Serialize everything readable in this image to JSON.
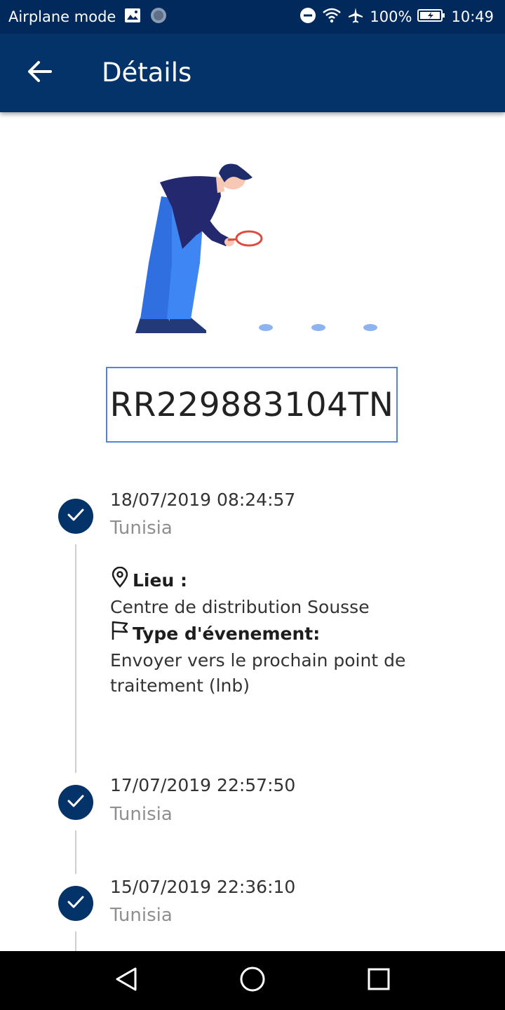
{
  "status_bar": {
    "mode_label": "Airplane mode",
    "battery": "100%",
    "time": "10:49"
  },
  "app_bar": {
    "title": "Détails"
  },
  "tracking_number": "RR229883104TN",
  "events": [
    {
      "datetime": "18/07/2019 08:24:57",
      "country": "Tunisia",
      "location_label": "Lieu :",
      "location": "Centre de distribution Sousse",
      "type_label": "Type d'évenement:",
      "type": "Envoyer vers le prochain point de traitement (lnb)"
    },
    {
      "datetime": "17/07/2019 22:57:50",
      "country": "Tunisia"
    },
    {
      "datetime": "15/07/2019 22:36:10",
      "country": "Tunisia"
    }
  ],
  "colors": {
    "primary": "#033369",
    "status_bar": "#02295c",
    "accent": "#4b86e0"
  },
  "icons": {
    "back": "arrow-left-icon",
    "check": "check-icon",
    "location": "map-pin-icon",
    "event_type": "flag-icon"
  }
}
